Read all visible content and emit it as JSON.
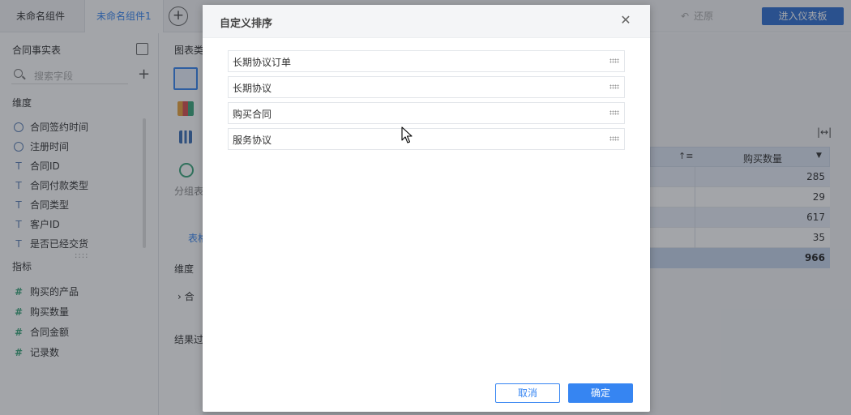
{
  "topbar": {
    "tabs": [
      {
        "label": "未命名组件"
      },
      {
        "label": "未命名组件1"
      }
    ],
    "restore_label": "还原",
    "enter_dashboard_label": "进入仪表板"
  },
  "left_panel": {
    "title": "合同事实表",
    "search_placeholder": "搜索字段",
    "dimension_section": "维度",
    "dimensions": [
      {
        "label": "合同签约时间",
        "icon": "clock-icon"
      },
      {
        "label": "注册时间",
        "icon": "clock-icon"
      },
      {
        "label": "合同ID",
        "icon": "text-type-icon"
      },
      {
        "label": "合同付款类型",
        "icon": "text-type-icon"
      },
      {
        "label": "合同类型",
        "icon": "text-type-icon"
      },
      {
        "label": "客户ID",
        "icon": "text-type-icon"
      },
      {
        "label": "是否已经交货",
        "icon": "text-type-icon"
      }
    ],
    "measure_section": "指标",
    "measures": [
      {
        "label": "购买的产品",
        "icon": "hash-icon"
      },
      {
        "label": "购买数量",
        "icon": "hash-icon"
      },
      {
        "label": "合同金额",
        "icon": "hash-icon"
      },
      {
        "label": "记录数",
        "icon": "hash-icon"
      }
    ]
  },
  "mid_panel": {
    "chart_type_label": "图表类",
    "group_table_label": "分组表",
    "table_label": "表格",
    "dimension_label": "维度",
    "dimension_item": "合",
    "result_filter_label": "结果过"
  },
  "table": {
    "column_header": "购买数量",
    "rows": [
      "285",
      "29",
      "617",
      "35"
    ],
    "total": "966"
  },
  "dialog": {
    "title": "自定义排序",
    "items": [
      {
        "label": "长期协议订单"
      },
      {
        "label": "长期协议"
      },
      {
        "label": "购买合同"
      },
      {
        "label": "服务协议"
      }
    ],
    "cancel_label": "取消",
    "confirm_label": "确定"
  },
  "colors": {
    "accent": "#3685f2",
    "dark_accent": "#2f6fd1",
    "header_bg": "#f4f5f7"
  }
}
